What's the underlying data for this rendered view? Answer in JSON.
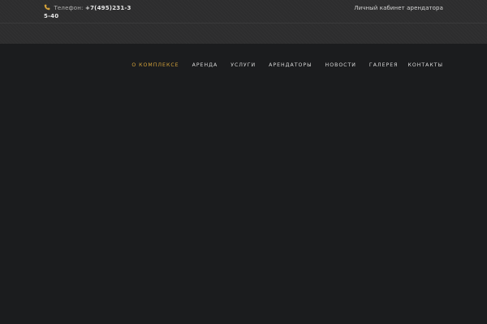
{
  "topbar": {
    "phone_label": "Телефон:",
    "phone_number": "+7(495)231-35-40",
    "cabinet_link": "Личный кабинет арендатора",
    "icon": "phone-icon",
    "icon_color": "#d4a23a"
  },
  "nav": {
    "items": [
      {
        "label": "О комплексе",
        "active": true
      },
      {
        "label": "Аренда",
        "active": false
      },
      {
        "label": "Услуги",
        "active": false
      },
      {
        "label": "Арендаторы",
        "active": false
      },
      {
        "label": "Новости",
        "active": false
      },
      {
        "label": "Галерея",
        "active": false
      },
      {
        "label": "Контакты",
        "active": false
      }
    ],
    "active_color": "#d4a23a"
  }
}
